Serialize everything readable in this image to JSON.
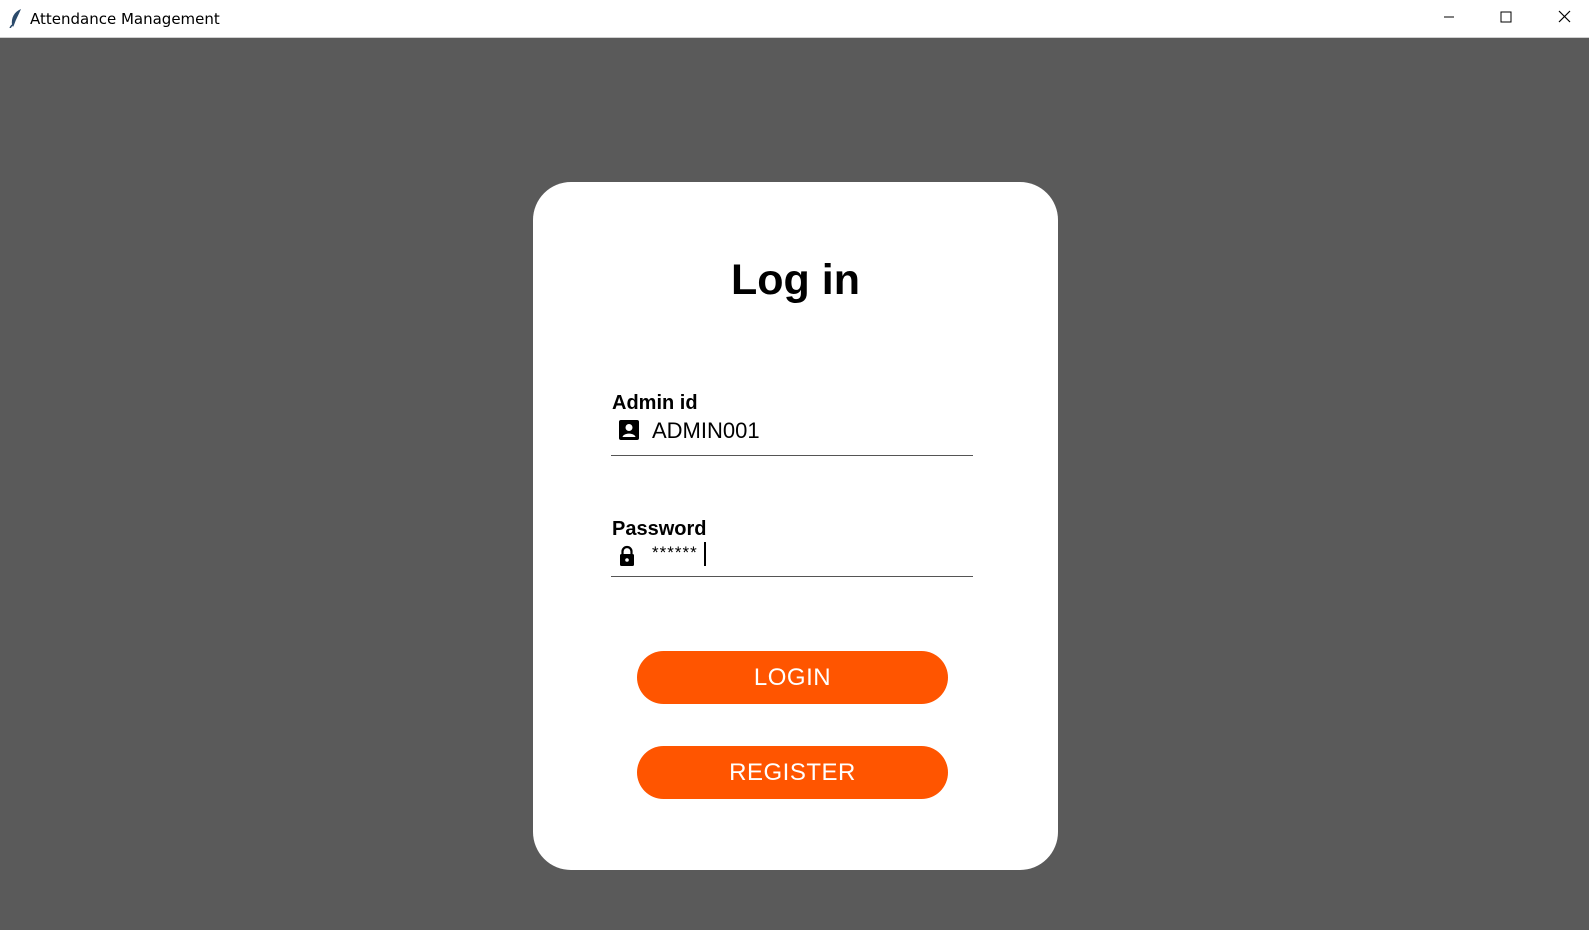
{
  "window": {
    "title": "Attendance Management",
    "icon": "feather-icon",
    "controls": [
      "minimize-icon",
      "maximize-icon",
      "close-icon"
    ]
  },
  "colors": {
    "background": "#5a5a5a",
    "card": "#ffffff",
    "accent": "#ff5500"
  },
  "login": {
    "heading": "Log in",
    "admin_id": {
      "label": "Admin id",
      "value": "ADMIN001",
      "icon": "account-box-icon"
    },
    "password": {
      "label": "Password",
      "value": "******",
      "icon": "lock-icon"
    },
    "login_button": "LOGIN",
    "register_button": "REGISTER"
  }
}
